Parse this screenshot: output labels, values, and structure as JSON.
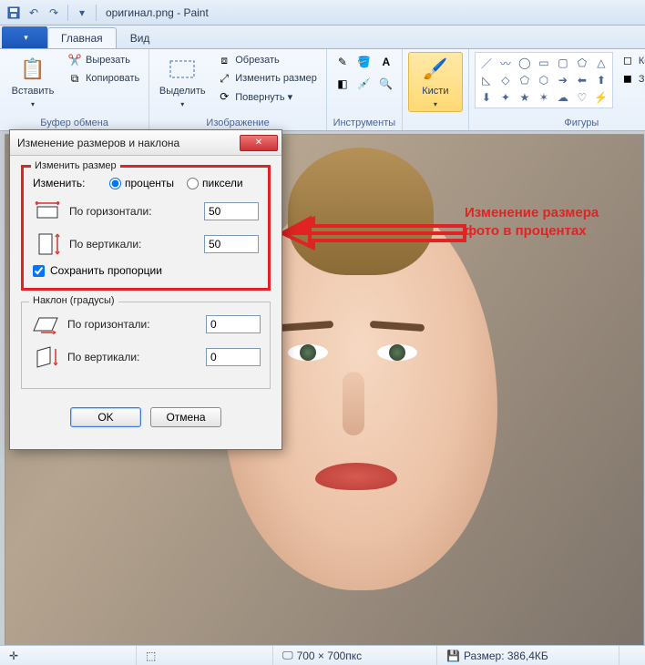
{
  "window": {
    "title": "оригинал.png - Paint"
  },
  "tabs": {
    "home": "Главная",
    "view": "Вид"
  },
  "ribbon": {
    "clipboard": {
      "label": "Буфер обмена",
      "paste": "Вставить",
      "cut": "Вырезать",
      "copy": "Копировать"
    },
    "image": {
      "label": "Изображение",
      "select": "Выделить",
      "crop": "Обрезать",
      "resize": "Изменить размер",
      "rotate": "Повернуть ▾"
    },
    "tools": {
      "label": "Инструменты"
    },
    "brushes": {
      "label": "Кисти"
    },
    "shapes": {
      "label": "Фигуры",
      "outline": "Контур ▾",
      "fill": "Заливка ▾"
    }
  },
  "dialog": {
    "title": "Изменение размеров и наклона",
    "resize": {
      "legend": "Изменить размер",
      "by_label": "Изменить:",
      "percent": "проценты",
      "pixels": "пиксели",
      "horizontal": "По горизонтали:",
      "vertical": "По вертикали:",
      "h_value": "50",
      "v_value": "50",
      "keep_aspect": "Сохранить пропорции"
    },
    "skew": {
      "legend": "Наклон (градусы)",
      "horizontal": "По горизонтали:",
      "vertical": "По вертикали:",
      "h_value": "0",
      "v_value": "0"
    },
    "ok": "OK",
    "cancel": "Отмена"
  },
  "annotation": {
    "text": "Изменение размера фото в процентах"
  },
  "statusbar": {
    "dims": "700 × 700пкс",
    "size": "Размер: 386,4КБ"
  }
}
